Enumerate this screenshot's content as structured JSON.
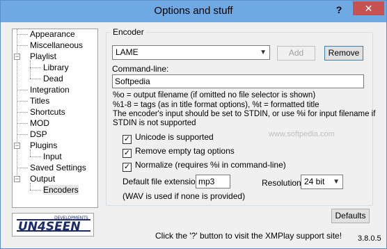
{
  "window": {
    "title": "Options and stuff",
    "help_label": "?",
    "close_label": "✕"
  },
  "tree": {
    "items": [
      {
        "label": "Appearance"
      },
      {
        "label": "Miscellaneous"
      },
      {
        "label": "Playlist"
      },
      {
        "label": "Library"
      },
      {
        "label": "Dead"
      },
      {
        "label": "Integration"
      },
      {
        "label": "Titles"
      },
      {
        "label": "Shortcuts"
      },
      {
        "label": "MOD"
      },
      {
        "label": "DSP"
      },
      {
        "label": "Plugins"
      },
      {
        "label": "Input"
      },
      {
        "label": "Saved Settings"
      },
      {
        "label": "Output"
      },
      {
        "label": "Encoders"
      }
    ],
    "selected": "Encoders"
  },
  "logo": {
    "text": "UN4SEEN",
    "subtext": "DEVELOPMENTS"
  },
  "encoder": {
    "group_label": "Encoder",
    "selected_encoder": "LAME",
    "add_label": "Add",
    "remove_label": "Remove",
    "commandline_label": "Command-line:",
    "commandline_value": "Softpedia",
    "info_lines": [
      "%o = output filename (if omitted no file selector is shown)",
      "%1-8 = tags (as in title format options), %t = formatted title",
      "The encoder's input should be set to STDIN, or use %i for input filename if",
      "STDIN is not supported"
    ],
    "options": [
      {
        "label": "Unicode is supported",
        "checked": true
      },
      {
        "label": "Remove empty tag options",
        "checked": true
      },
      {
        "label": "Normalize (requires %i in command-line)",
        "checked": true
      }
    ],
    "extension_label": "Default file extension:",
    "extension_value": "mp3",
    "resolution_label": "Resolution:",
    "resolution_value": "24 bit",
    "wav_note": "(WAV is used if none is provided)"
  },
  "watermark": "www.softpedia.com",
  "defaults_label": "Defaults",
  "status_text": "Click the '?' button to visit the XMPlay support site!",
  "version": "3.8.0.5",
  "colors": {
    "titlebar": "#6fa9e4",
    "close_button": "#c75050"
  }
}
